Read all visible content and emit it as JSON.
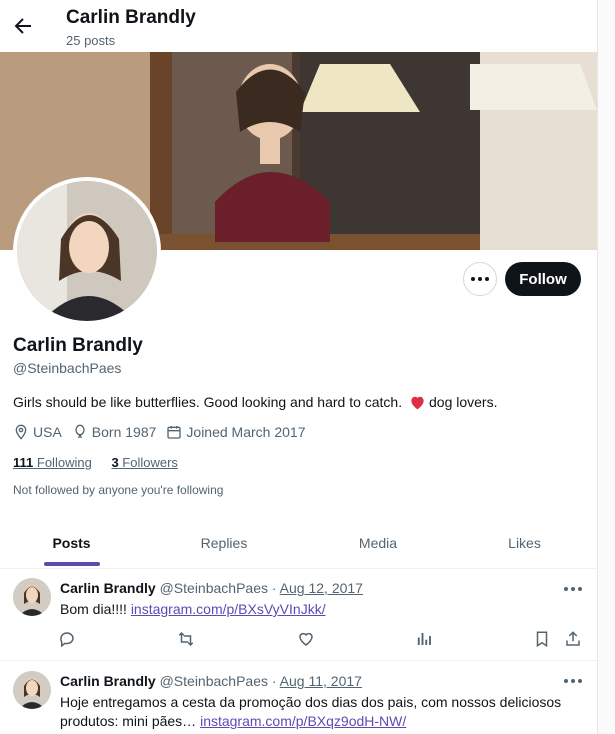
{
  "header": {
    "title": "Carlin Brandly",
    "posts": "25 posts"
  },
  "profile": {
    "name": "Carlin Brandly",
    "handle": "@SteinbachPaes",
    "bio_before": "Girls should be like butterflies. Good looking and hard to catch.",
    "bio_after": "dog lovers.",
    "location": "USA",
    "born": "Born 1987",
    "joined": "Joined March 2017",
    "following_count": "111",
    "following_label": "Following",
    "followers_count": "3",
    "followers_label": "Followers",
    "not_followed": "Not followed by anyone you're following",
    "follow_label": "Follow"
  },
  "tabs": [
    {
      "label": "Posts"
    },
    {
      "label": "Replies"
    },
    {
      "label": "Media"
    },
    {
      "label": "Likes"
    }
  ],
  "posts": [
    {
      "name": "Carlin Brandly",
      "handle": "@SteinbachPaes",
      "sep": "·",
      "date": "Aug 12, 2017",
      "text": "Bom dia!!!! ",
      "link": "instagram.com/p/BXsVyVInJkk/"
    },
    {
      "name": "Carlin Brandly",
      "handle": "@SteinbachPaes",
      "sep": "·",
      "date": "Aug 11, 2017",
      "text": "Hoje entregamos a cesta da promoção dos dias dos pais, com nossos deliciosos produtos: mini pães… ",
      "link": "instagram.com/p/BXqz9odH-NW/"
    }
  ],
  "colors": {
    "accent": "#5b4bb3",
    "text": "#0f1419",
    "muted": "#536471",
    "heart": "#e0245e"
  }
}
